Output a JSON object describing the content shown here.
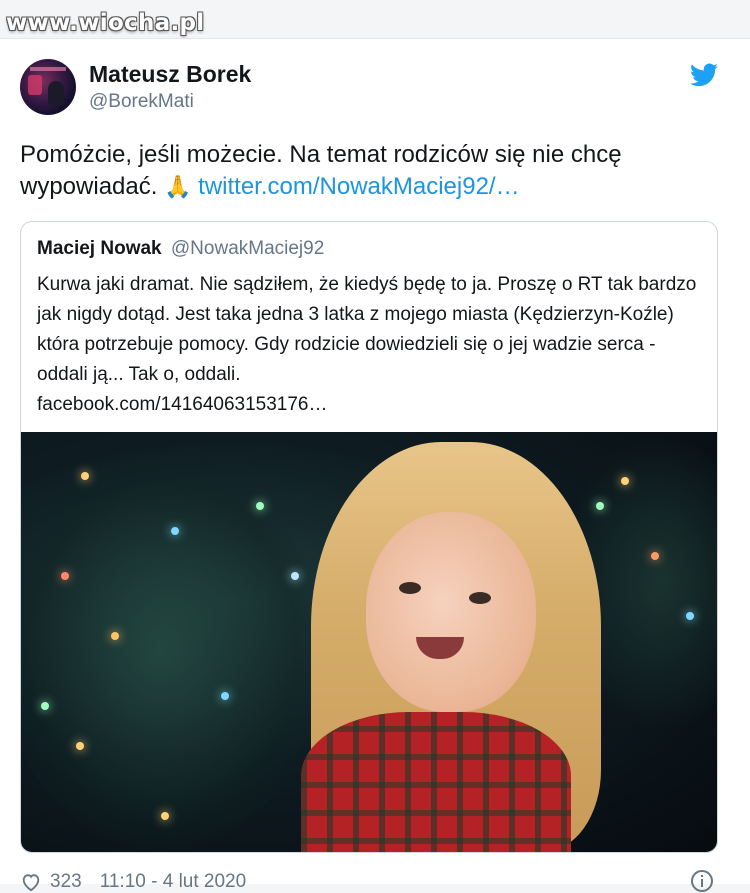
{
  "watermark": {
    "text": "www.wiocha.pl"
  },
  "tweet": {
    "author_name": "Mateusz Borek",
    "author_handle": "@BorekMati",
    "text_before_emoji": "Pomóżcie, jeśli możecie. Na temat rodziców się nie chcę wypowiadać.",
    "emoji": "🙏",
    "link": "twitter.com/NowakMaciej92/…",
    "likes": "323",
    "timestamp": "11:10 - 4 lut 2020"
  },
  "quoted_tweet": {
    "author_name": "Maciej Nowak",
    "author_handle": "@NowakMaciej92",
    "text": "Kurwa jaki dramat. Nie sądziłem, że kiedyś będę to ja. Proszę o RT tak bardzo jak nigdy dotąd. Jest taka jedna 3 latka z mojego miasta (Kędzierzyn-Koźle) która potrzebuje pomocy. Gdy rodzicie dowiedzieli się o jej wadzie serca - oddali ją... Tak o, oddali.",
    "link": "facebook.com/14164063153176…"
  },
  "icons": {
    "brand": "twitter-bird-icon",
    "like": "heart-icon",
    "info": "info-icon"
  },
  "colors": {
    "link": "#1b95e0",
    "twitter_blue": "#1da1f2",
    "muted": "#657786"
  }
}
